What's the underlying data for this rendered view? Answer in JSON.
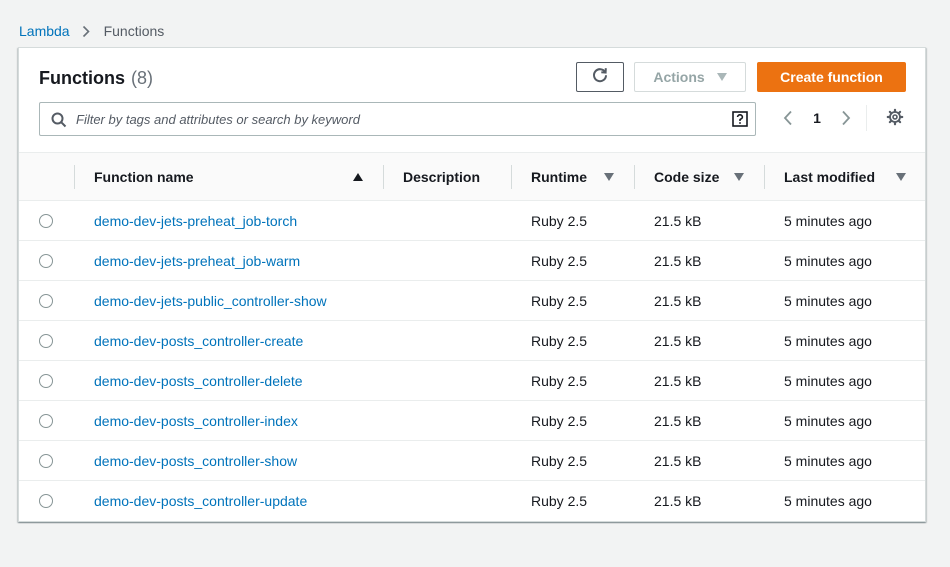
{
  "breadcrumb": {
    "root": "Lambda",
    "current": "Functions"
  },
  "panel": {
    "title": "Functions",
    "count": "(8)"
  },
  "toolbar": {
    "actions_label": "Actions",
    "create_label": "Create function"
  },
  "search": {
    "placeholder": "Filter by tags and attributes or search by keyword",
    "value": ""
  },
  "pagination": {
    "current_page": "1"
  },
  "table": {
    "columns": {
      "name": "Function name",
      "description": "Description",
      "runtime": "Runtime",
      "code_size": "Code size",
      "last_modified": "Last modified"
    },
    "sort": {
      "column": "Function name",
      "direction": "ascending"
    },
    "rows": [
      {
        "name": "demo-dev-jets-preheat_job-torch",
        "description": "",
        "runtime": "Ruby 2.5",
        "code_size": "21.5 kB",
        "last_modified": "5 minutes ago"
      },
      {
        "name": "demo-dev-jets-preheat_job-warm",
        "description": "",
        "runtime": "Ruby 2.5",
        "code_size": "21.5 kB",
        "last_modified": "5 minutes ago"
      },
      {
        "name": "demo-dev-jets-public_controller-show",
        "description": "",
        "runtime": "Ruby 2.5",
        "code_size": "21.5 kB",
        "last_modified": "5 minutes ago"
      },
      {
        "name": "demo-dev-posts_controller-create",
        "description": "",
        "runtime": "Ruby 2.5",
        "code_size": "21.5 kB",
        "last_modified": "5 minutes ago"
      },
      {
        "name": "demo-dev-posts_controller-delete",
        "description": "",
        "runtime": "Ruby 2.5",
        "code_size": "21.5 kB",
        "last_modified": "5 minutes ago"
      },
      {
        "name": "demo-dev-posts_controller-index",
        "description": "",
        "runtime": "Ruby 2.5",
        "code_size": "21.5 kB",
        "last_modified": "5 minutes ago"
      },
      {
        "name": "demo-dev-posts_controller-show",
        "description": "",
        "runtime": "Ruby 2.5",
        "code_size": "21.5 kB",
        "last_modified": "5 minutes ago"
      },
      {
        "name": "demo-dev-posts_controller-update",
        "description": "",
        "runtime": "Ruby 2.5",
        "code_size": "21.5 kB",
        "last_modified": "5 minutes ago"
      }
    ]
  },
  "icons": {
    "refresh": "refresh-icon",
    "search": "search-icon",
    "help": "help-icon",
    "prev": "chevron-left-icon",
    "next": "chevron-right-icon",
    "settings": "gear-icon",
    "breadcrumb_separator": "chevron-right-icon"
  },
  "colors": {
    "primary_button": "#ec7211",
    "link": "#0073bb",
    "background": "#f2f3f3"
  }
}
